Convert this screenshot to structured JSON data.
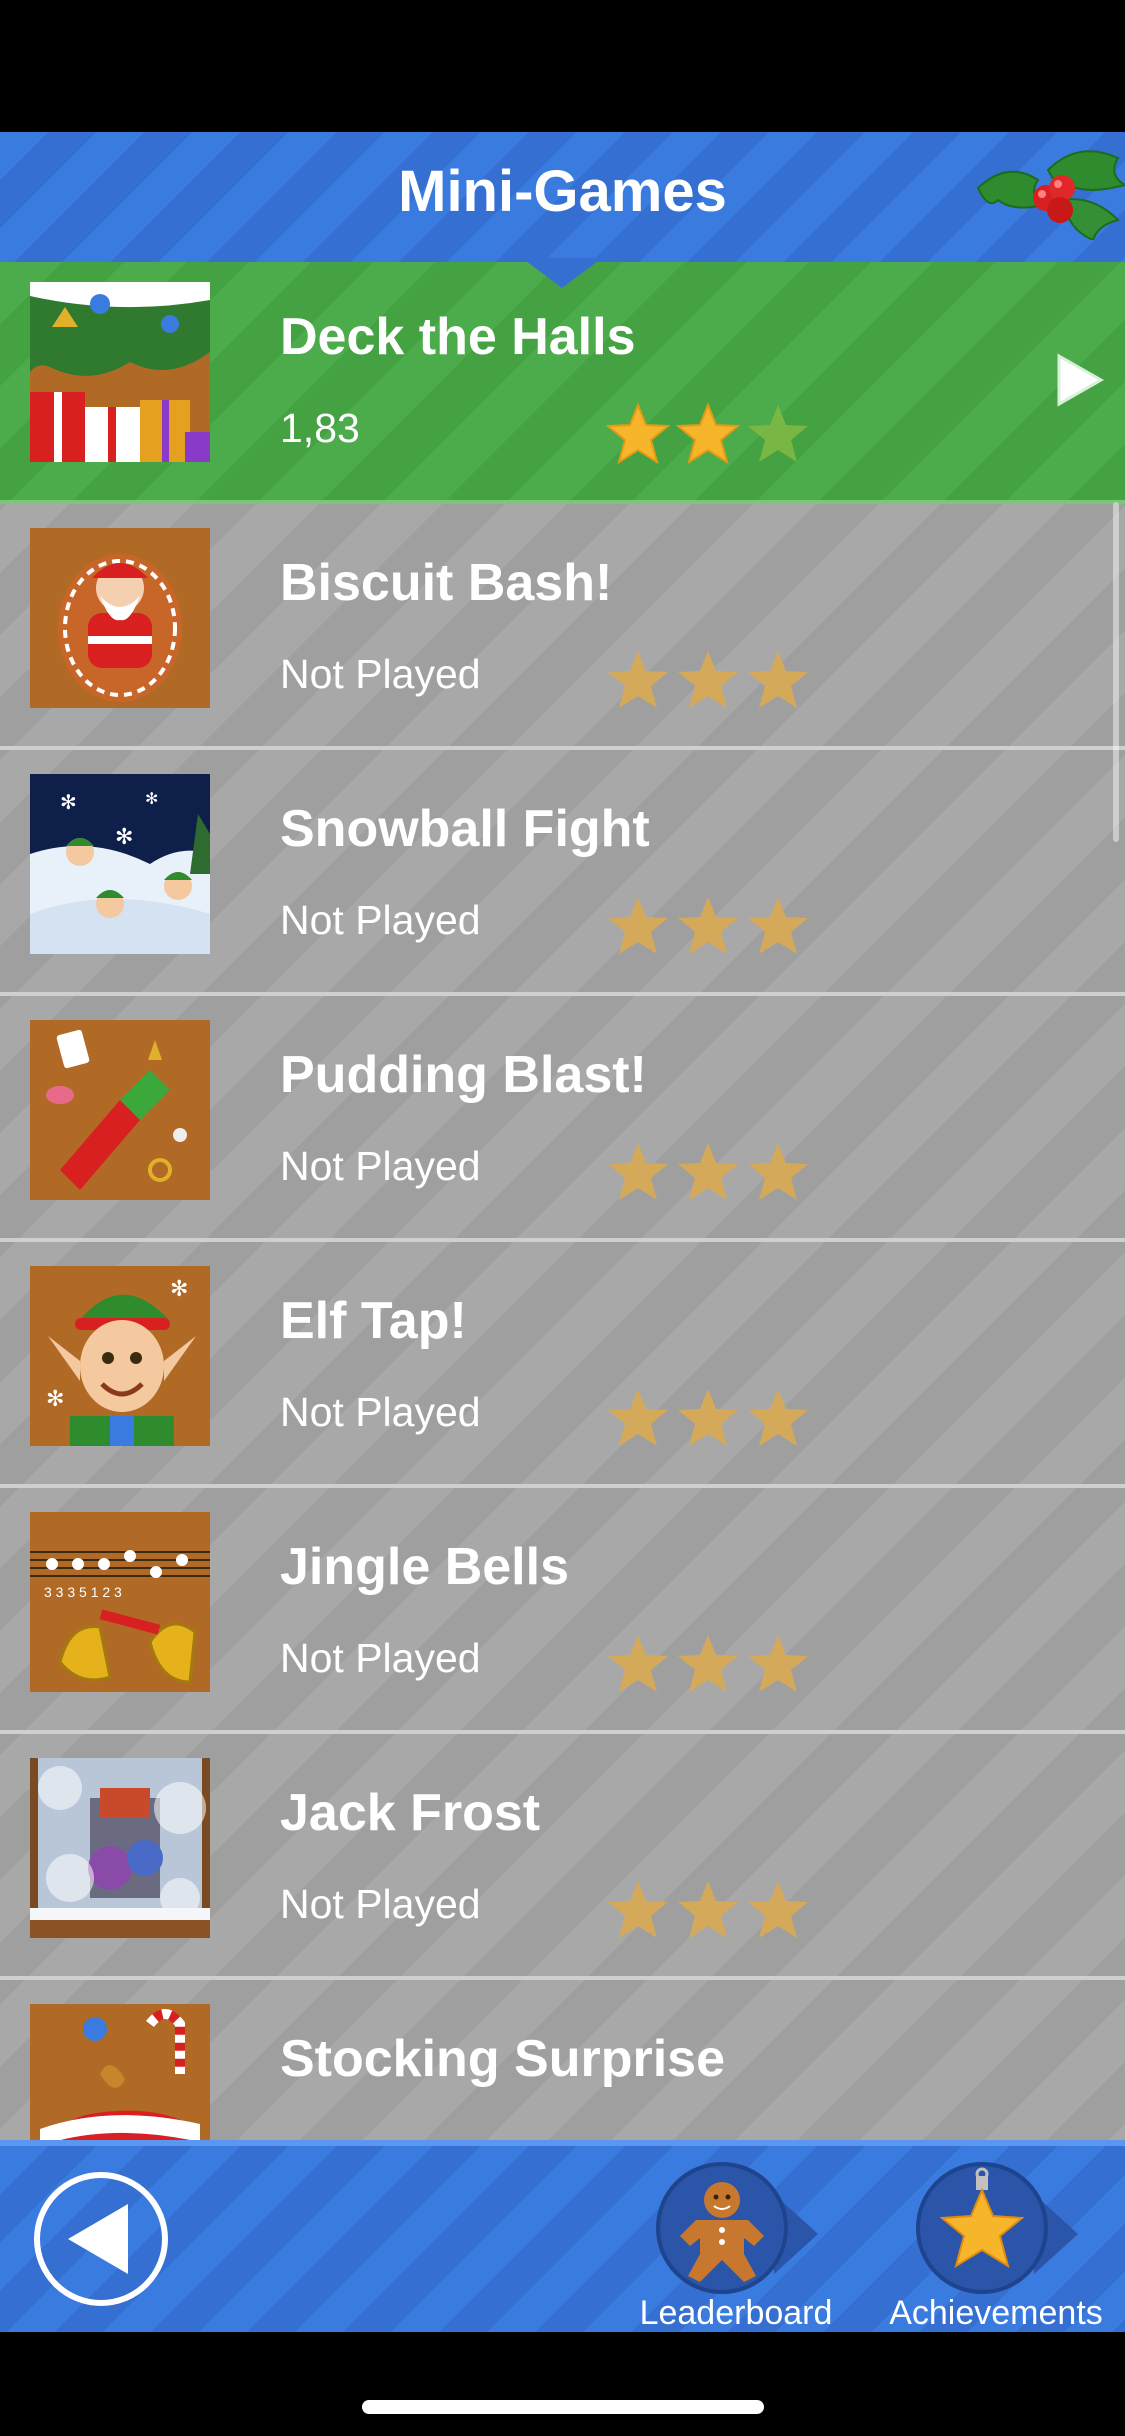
{
  "header": {
    "title": "Mini-Games"
  },
  "games": [
    {
      "title": "Deck the Halls",
      "score": "1,83",
      "stars_earned": 2,
      "selected": true
    },
    {
      "title": "Biscuit Bash!",
      "score": "Not Played",
      "stars_earned": 0,
      "selected": false
    },
    {
      "title": "Snowball Fight",
      "score": "Not Played",
      "stars_earned": 0,
      "selected": false
    },
    {
      "title": "Pudding Blast!",
      "score": "Not Played",
      "stars_earned": 0,
      "selected": false
    },
    {
      "title": "Elf Tap!",
      "score": "Not Played",
      "stars_earned": 0,
      "selected": false
    },
    {
      "title": "Jingle Bells",
      "score": "Not Played",
      "stars_earned": 0,
      "selected": false
    },
    {
      "title": "Jack Frost",
      "score": "Not Played",
      "stars_earned": 0,
      "selected": false
    },
    {
      "title": "Stocking Surprise",
      "score": "",
      "stars_earned": 0,
      "selected": false
    }
  ],
  "bottom_bar": {
    "leaderboard_label": "Leaderboard",
    "achievements_label": "Achievements"
  },
  "colors": {
    "header_blue": "#3a7be0",
    "selected_green": "#4cab4a",
    "row_gray": "#a8a8a8",
    "star_gold": "#f7b52c",
    "star_empty": "#d4aa5a"
  },
  "icons": [
    "holly-icon",
    "play-arrow-icon",
    "star-icon",
    "back-arrow-icon",
    "gingerbread-man-icon",
    "star-ornament-icon"
  ]
}
